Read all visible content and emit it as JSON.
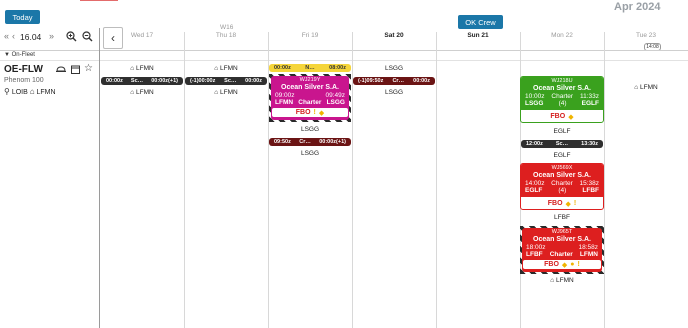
{
  "toolbar": {
    "today_label": "Today",
    "ok_crew_label": "OK Crew",
    "month_label": "Apr 2024",
    "date_value": "16.04",
    "nav_prev_fast": "«",
    "nav_prev": "‹",
    "nav_next_fast": "»",
    "chevron": "‹"
  },
  "calendar": {
    "week_label": "W16",
    "days": [
      {
        "label": "Wed 17",
        "bold": false
      },
      {
        "label": "Thu 18",
        "bold": false
      },
      {
        "label": "Fri 19",
        "bold": false
      },
      {
        "label": "Sat 20",
        "bold": true
      },
      {
        "label": "Sun 21",
        "bold": true
      },
      {
        "label": "Mon 22",
        "bold": false
      },
      {
        "label": "Tue 23",
        "bold": false
      }
    ],
    "today_badge": "14:08"
  },
  "fleet": {
    "group_label": "On-Fleet",
    "registration": "OE-FLW",
    "aircraft_type": "Phenom 100",
    "base_primary": "LOIB",
    "base_home": "LFMN"
  },
  "locations": {
    "wed_top": "LFMN",
    "wed_bottom": "LFMN",
    "thu_top": "LFMN",
    "thu_bottom": "LFMN",
    "fri_after": "LSGG",
    "fri_bottom": "LSGG",
    "sat_top": "LSGG",
    "sat_bottom": "LSGG",
    "tue_loc": "LFMN",
    "mon_egfl_1": "EGLF",
    "mon_egfl_2": "EGLF",
    "mon_lfbf": "LFBF",
    "mon_lfmn": "LFMN"
  },
  "bars": {
    "dark1": {
      "left": "00:00z",
      "mid": "Sc…",
      "right": "00:00z(+1)"
    },
    "dark2": {
      "left": "(-1)00:00z",
      "mid": "Sc…",
      "right": "00:00z"
    },
    "yellow": {
      "left": "00:00z",
      "mid": "N…",
      "right": "08:00z"
    },
    "maroon1": {
      "left": "(-1)09:50z",
      "mid": "Cr…",
      "right": "00:00z"
    },
    "maroon2": {
      "left": "09:50z",
      "mid": "Cr…",
      "right": "00:00z(+1)"
    },
    "dark3": {
      "left": "12:00z",
      "mid": "Sc…",
      "right": "13:30z"
    }
  },
  "flights": [
    {
      "id": "WJ219Y",
      "operator": "Ocean Silver S.A.",
      "dep_time": "09:00z",
      "arr_time": "09:49z",
      "dep": "LFMN",
      "arr": "LSGG",
      "type": "Charter",
      "pax": "",
      "fbo": "FBO",
      "color": "#c9158e"
    },
    {
      "id": "WJ218U",
      "operator": "Ocean Silver S.A.",
      "dep_time": "10:00z",
      "arr_time": "11:33z",
      "dep": "LSGG",
      "arr": "EGLF",
      "type": "Charter",
      "pax": "(4)",
      "fbo": "FBO",
      "color": "#3aa11e"
    },
    {
      "id": "WJ569X",
      "operator": "Ocean Silver S.A.",
      "dep_time": "14:00z",
      "arr_time": "15:38z",
      "dep": "EGLF",
      "arr": "LFBF",
      "type": "Charter",
      "pax": "(4)",
      "fbo": "FBO",
      "color": "#dd1f1f"
    },
    {
      "id": "WJ965T",
      "operator": "Ocean Silver S.A.",
      "dep_time": "18:00z",
      "arr_time": "18:58z",
      "dep": "LFBF",
      "arr": "LFMN",
      "type": "Charter",
      "pax": "",
      "fbo": "FBO",
      "color": "#dd1f1f"
    }
  ]
}
